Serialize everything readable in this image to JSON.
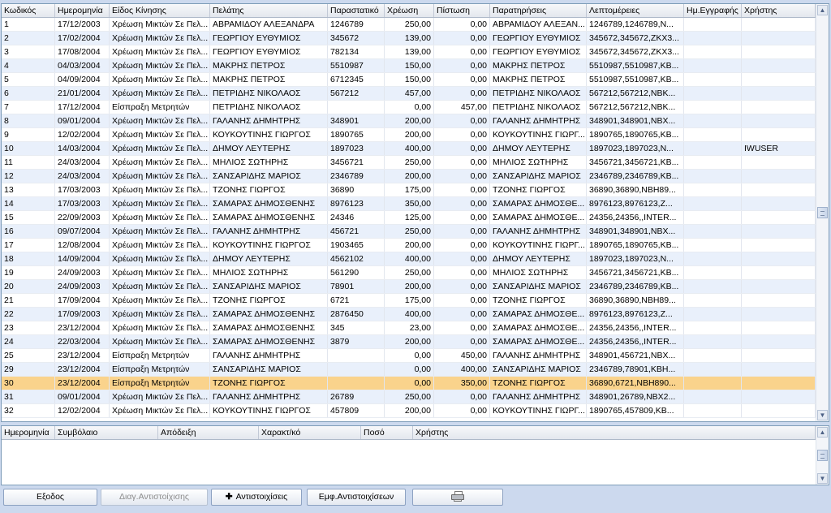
{
  "main_grid": {
    "columns": [
      {
        "key": "id",
        "label": "Κωδικός",
        "width": 66,
        "num": false
      },
      {
        "key": "date",
        "label": "Ημερομηνία",
        "width": 67,
        "num": false
      },
      {
        "key": "type",
        "label": "Είδος Κίνησης",
        "width": 124,
        "num": false
      },
      {
        "key": "client",
        "label": "Πελάτης",
        "width": 145,
        "num": false
      },
      {
        "key": "doc",
        "label": "Παραστατικό",
        "width": 70,
        "num": false
      },
      {
        "key": "debit",
        "label": "Χρέωση",
        "width": 61,
        "num": true
      },
      {
        "key": "credit",
        "label": "Πίστωση",
        "width": 69,
        "num": true
      },
      {
        "key": "notes",
        "label": "Παρατηρήσεις",
        "width": 119,
        "num": false
      },
      {
        "key": "details",
        "label": "Λεπτομέρειες",
        "width": 120,
        "num": false
      },
      {
        "key": "regdate",
        "label": "Ημ.Εγγραφής",
        "width": 71,
        "num": false
      },
      {
        "key": "user",
        "label": "Χρήστης",
        "width": 91,
        "num": false
      }
    ],
    "rows": [
      [
        "1",
        "17/12/2003",
        "Χρέωση Μικτών Σε Πελ...",
        "ΑΒΡΑΜΙΔΟΥ ΑΛΕΞΑΝΔΡΑ",
        "1246789",
        "250,00",
        "0,00",
        "ΑΒΡΑΜΙΔΟΥ ΑΛΕΞΑΝ...",
        "1246789,1246789,N...",
        "",
        ""
      ],
      [
        "2",
        "17/02/2004",
        "Χρέωση Μικτών Σε Πελ...",
        "ΓΕΩΡΓΙΟΥ ΕΥΘΥΜΙΟΣ",
        "345672",
        "139,00",
        "0,00",
        "ΓΕΩΡΓΙΟΥ ΕΥΘΥΜΙΟΣ",
        "345672,345672,ZKX3...",
        "",
        ""
      ],
      [
        "3",
        "17/08/2004",
        "Χρέωση Μικτών Σε Πελ...",
        "ΓΕΩΡΓΙΟΥ ΕΥΘΥΜΙΟΣ",
        "782134",
        "139,00",
        "0,00",
        "ΓΕΩΡΓΙΟΥ ΕΥΘΥΜΙΟΣ",
        "345672,345672,ZKX3...",
        "",
        ""
      ],
      [
        "4",
        "04/03/2004",
        "Χρέωση Μικτών Σε Πελ...",
        "ΜΑΚΡΗΣ ΠΕΤΡΟΣ",
        "5510987",
        "150,00",
        "0,00",
        "ΜΑΚΡΗΣ ΠΕΤΡΟΣ",
        "5510987,5510987,KB...",
        "",
        ""
      ],
      [
        "5",
        "04/09/2004",
        "Χρέωση Μικτών Σε Πελ...",
        "ΜΑΚΡΗΣ ΠΕΤΡΟΣ",
        "6712345",
        "150,00",
        "0,00",
        "ΜΑΚΡΗΣ ΠΕΤΡΟΣ",
        "5510987,5510987,KB...",
        "",
        ""
      ],
      [
        "6",
        "21/01/2004",
        "Χρέωση Μικτών Σε Πελ...",
        "ΠΕΤΡΙΔΗΣ ΝΙΚΟΛΑΟΣ",
        "567212",
        "457,00",
        "0,00",
        "ΠΕΤΡΙΔΗΣ ΝΙΚΟΛΑΟΣ",
        "567212,567212,NBK...",
        "",
        ""
      ],
      [
        "7",
        "17/12/2004",
        "Είσπραξη Μετρητών",
        "ΠΕΤΡΙΔΗΣ ΝΙΚΟΛΑΟΣ",
        "",
        "0,00",
        "457,00",
        "ΠΕΤΡΙΔΗΣ ΝΙΚΟΛΑΟΣ",
        "567212,567212,NBK...",
        "",
        ""
      ],
      [
        "8",
        "09/01/2004",
        "Χρέωση Μικτών Σε Πελ...",
        "ΓΑΛΑΝΗΣ ΔΗΜΗΤΡΗΣ",
        "348901",
        "200,00",
        "0,00",
        "ΓΑΛΑΝΗΣ ΔΗΜΗΤΡΗΣ",
        "348901,348901,NBX...",
        "",
        ""
      ],
      [
        "9",
        "12/02/2004",
        "Χρέωση Μικτών Σε Πελ...",
        "ΚΟΥΚΟΥΤΙΝΗΣ ΓΙΩΡΓΟΣ",
        "1890765",
        "200,00",
        "0,00",
        "ΚΟΥΚΟΥΤΙΝΗΣ ΓΙΩΡΓ...",
        "1890765,1890765,KB...",
        "",
        ""
      ],
      [
        "10",
        "14/03/2004",
        "Χρέωση Μικτών Σε Πελ...",
        "ΔΗΜΟΥ ΛΕΥΤΕΡΗΣ",
        "1897023",
        "400,00",
        "0,00",
        "ΔΗΜΟΥ ΛΕΥΤΕΡΗΣ",
        "1897023,1897023,N...",
        "",
        "IWUSER"
      ],
      [
        "11",
        "24/03/2004",
        "Χρέωση Μικτών Σε Πελ...",
        "ΜΗΛΙΟΣ ΣΩΤΗΡΗΣ",
        "3456721",
        "250,00",
        "0,00",
        "ΜΗΛΙΟΣ ΣΩΤΗΡΗΣ",
        "3456721,3456721,KB...",
        "",
        ""
      ],
      [
        "12",
        "24/03/2004",
        "Χρέωση Μικτών Σε Πελ...",
        "ΣΑΝΣΑΡΙΔΗΣ ΜΑΡΙΟΣ",
        "2346789",
        "200,00",
        "0,00",
        "ΣΑΝΣΑΡΙΔΗΣ ΜΑΡΙΟΣ",
        "2346789,2346789,KB...",
        "",
        ""
      ],
      [
        "13",
        "17/03/2003",
        "Χρέωση Μικτών Σε Πελ...",
        "ΤΖΟΝΗΣ ΓΙΩΡΓΟΣ",
        "36890",
        "175,00",
        "0,00",
        "ΤΖΟΝΗΣ ΓΙΩΡΓΟΣ",
        "36890,36890,NBH89...",
        "",
        ""
      ],
      [
        "14",
        "17/03/2003",
        "Χρέωση Μικτών Σε Πελ...",
        "ΣΑΜΑΡΑΣ ΔΗΜΟΣΘΕΝΗΣ",
        "8976123",
        "350,00",
        "0,00",
        "ΣΑΜΑΡΑΣ ΔΗΜΟΣΘΕ...",
        "8976123,8976123,Z...",
        "",
        ""
      ],
      [
        "15",
        "22/09/2003",
        "Χρέωση Μικτών Σε Πελ...",
        "ΣΑΜΑΡΑΣ ΔΗΜΟΣΘΕΝΗΣ",
        "24346",
        "125,00",
        "0,00",
        "ΣΑΜΑΡΑΣ ΔΗΜΟΣΘΕ...",
        "24356,24356,,INTER...",
        "",
        ""
      ],
      [
        "16",
        "09/07/2004",
        "Χρέωση Μικτών Σε Πελ...",
        "ΓΑΛΑΝΗΣ ΔΗΜΗΤΡΗΣ",
        "456721",
        "250,00",
        "0,00",
        "ΓΑΛΑΝΗΣ ΔΗΜΗΤΡΗΣ",
        "348901,348901,NBX...",
        "",
        ""
      ],
      [
        "17",
        "12/08/2004",
        "Χρέωση Μικτών Σε Πελ...",
        "ΚΟΥΚΟΥΤΙΝΗΣ ΓΙΩΡΓΟΣ",
        "1903465",
        "200,00",
        "0,00",
        "ΚΟΥΚΟΥΤΙΝΗΣ ΓΙΩΡΓ...",
        "1890765,1890765,KB...",
        "",
        ""
      ],
      [
        "18",
        "14/09/2004",
        "Χρέωση Μικτών Σε Πελ...",
        "ΔΗΜΟΥ ΛΕΥΤΕΡΗΣ",
        "4562102",
        "400,00",
        "0,00",
        "ΔΗΜΟΥ ΛΕΥΤΕΡΗΣ",
        "1897023,1897023,N...",
        "",
        ""
      ],
      [
        "19",
        "24/09/2003",
        "Χρέωση Μικτών Σε Πελ...",
        "ΜΗΛΙΟΣ ΣΩΤΗΡΗΣ",
        "561290",
        "250,00",
        "0,00",
        "ΜΗΛΙΟΣ ΣΩΤΗΡΗΣ",
        "3456721,3456721,KB...",
        "",
        ""
      ],
      [
        "20",
        "24/09/2003",
        "Χρέωση Μικτών Σε Πελ...",
        "ΣΑΝΣΑΡΙΔΗΣ ΜΑΡΙΟΣ",
        "78901",
        "200,00",
        "0,00",
        "ΣΑΝΣΑΡΙΔΗΣ ΜΑΡΙΟΣ",
        "2346789,2346789,KB...",
        "",
        ""
      ],
      [
        "21",
        "17/09/2004",
        "Χρέωση Μικτών Σε Πελ...",
        "ΤΖΟΝΗΣ ΓΙΩΡΓΟΣ",
        "6721",
        "175,00",
        "0,00",
        "ΤΖΟΝΗΣ ΓΙΩΡΓΟΣ",
        "36890,36890,NBH89...",
        "",
        ""
      ],
      [
        "22",
        "17/09/2003",
        "Χρέωση Μικτών Σε Πελ...",
        "ΣΑΜΑΡΑΣ ΔΗΜΟΣΘΕΝΗΣ",
        "2876450",
        "400,00",
        "0,00",
        "ΣΑΜΑΡΑΣ ΔΗΜΟΣΘΕ...",
        "8976123,8976123,Z...",
        "",
        ""
      ],
      [
        "23",
        "23/12/2004",
        "Χρέωση Μικτών Σε Πελ...",
        "ΣΑΜΑΡΑΣ ΔΗΜΟΣΘΕΝΗΣ",
        "345",
        "23,00",
        "0,00",
        "ΣΑΜΑΡΑΣ ΔΗΜΟΣΘΕ...",
        "24356,24356,,INTER...",
        "",
        ""
      ],
      [
        "24",
        "22/03/2004",
        "Χρέωση Μικτών Σε Πελ...",
        "ΣΑΜΑΡΑΣ ΔΗΜΟΣΘΕΝΗΣ",
        "3879",
        "200,00",
        "0,00",
        "ΣΑΜΑΡΑΣ ΔΗΜΟΣΘΕ...",
        "24356,24356,,INTER...",
        "",
        ""
      ],
      [
        "25",
        "23/12/2004",
        "Είσπραξη Μετρητών",
        "ΓΑΛΑΝΗΣ ΔΗΜΗΤΡΗΣ",
        "",
        "0,00",
        "450,00",
        "ΓΑΛΑΝΗΣ ΔΗΜΗΤΡΗΣ",
        "348901,456721,NBX...",
        "",
        ""
      ],
      [
        "29",
        "23/12/2004",
        "Είσπραξη Μετρητών",
        "ΣΑΝΣΑΡΙΔΗΣ ΜΑΡΙΟΣ",
        "",
        "0,00",
        "400,00",
        "ΣΑΝΣΑΡΙΔΗΣ ΜΑΡΙΟΣ",
        "2346789,78901,KBH...",
        "",
        ""
      ],
      [
        "30",
        "23/12/2004",
        "Είσπραξη Μετρητών",
        "ΤΖΟΝΗΣ ΓΙΩΡΓΟΣ",
        "",
        "0,00",
        "350,00",
        "ΤΖΟΝΗΣ ΓΙΩΡΓΟΣ",
        "36890,6721,NBH890...",
        "",
        ""
      ],
      [
        "31",
        "09/01/2004",
        "Χρέωση Μικτών Σε Πελ...",
        "ΓΑΛΑΝΗΣ ΔΗΜΗΤΡΗΣ",
        "26789",
        "250,00",
        "0,00",
        "ΓΑΛΑΝΗΣ ΔΗΜΗΤΡΗΣ",
        "348901,26789,NBX2...",
        "",
        ""
      ],
      [
        "32",
        "12/02/2004",
        "Χρέωση Μικτών Σε Πελ...",
        "ΚΟΥΚΟΥΤΙΝΗΣ ΓΙΩΡΓΟΣ",
        "457809",
        "200,00",
        "0,00",
        "ΚΟΥΚΟΥΤΙΝΗΣ ΓΙΩΡΓ...",
        "1890765,457809,KB...",
        "",
        ""
      ]
    ],
    "selected_row_index": 26,
    "scroll_position": 0.5
  },
  "detail_grid": {
    "columns": [
      {
        "label": "Ημερομηνία",
        "width": 66
      },
      {
        "label": "Συμβόλαιο",
        "width": 127
      },
      {
        "label": "Απόδειξη",
        "width": 124
      },
      {
        "label": "Χαρακτ/κό",
        "width": 126
      },
      {
        "label": "Ποσό",
        "width": 64
      },
      {
        "label": "Χρήστης",
        "width": 496
      }
    ],
    "scroll_position": 0.5
  },
  "buttons": {
    "exit": "Εξοδος",
    "delete_match": "Διαγ.Αντιστοίχισης",
    "matches": "Αντιστοιχίσεις",
    "show_matches": "Εμφ.Αντιστοιχίσεων",
    "print_icon": "printer-icon"
  },
  "colors": {
    "selected_row": "#fad38c",
    "alt_row": "#e9f0fb",
    "background": "#ccd9ee"
  }
}
